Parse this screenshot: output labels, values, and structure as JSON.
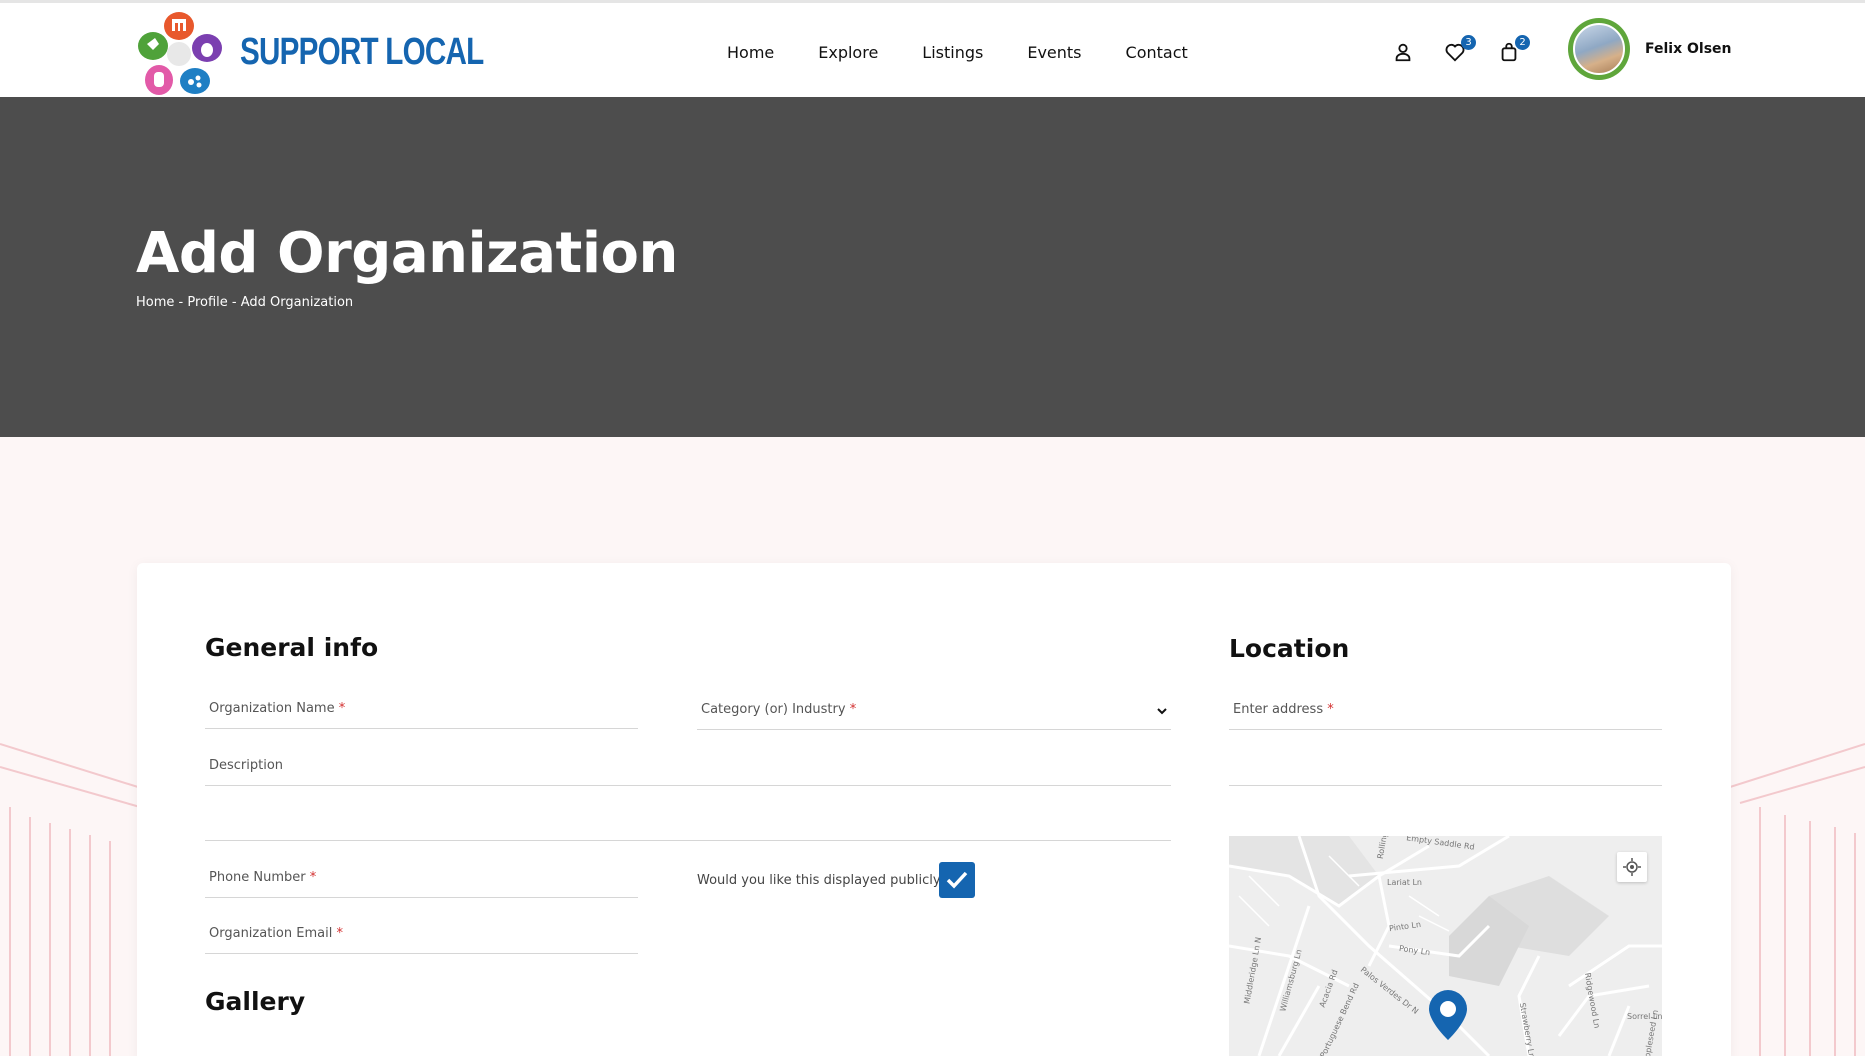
{
  "brand": {
    "name": "SUPPORT LOCAL",
    "color": "#1565b0"
  },
  "nav": {
    "items": [
      {
        "label": "Home"
      },
      {
        "label": "Explore"
      },
      {
        "label": "Listings"
      },
      {
        "label": "Events"
      },
      {
        "label": "Contact"
      }
    ]
  },
  "header_icons": {
    "account": "user-icon",
    "favorites": {
      "icon": "heart-icon",
      "count": "3"
    },
    "cart": {
      "icon": "shopping-bag-icon",
      "count": "2"
    }
  },
  "user": {
    "name": "Felix Olsen"
  },
  "hero": {
    "title": "Add Organization",
    "breadcrumb": [
      "Home",
      "Profile",
      "Add Organization"
    ],
    "separator": " - "
  },
  "general_info": {
    "title": "General info",
    "org_name_label": "Organization Name",
    "category_label": "Category (or) Industry",
    "description_label": "Description",
    "phone_label": "Phone Number",
    "public_question": "Would you like this displayed publicly?",
    "public_checked": true,
    "email_label": "Organization Email",
    "required_mark": "*"
  },
  "location": {
    "title": "Location",
    "address_label": "Enter address"
  },
  "gallery": {
    "title": "Gallery"
  },
  "map": {
    "streets": [
      "Empty Saddle Rd",
      "Lariat Ln",
      "Pinto Ln",
      "Pony Ln",
      "Middleridge Ln N",
      "Williamsburg Ln",
      "Acacia Rd",
      "Portuguese Bend Rd",
      "Palos Verdes Dr N",
      "Strawberry Ln",
      "Rolling",
      "Sorrel Ln",
      "Appleseed Ln",
      "Ridgewood Ln"
    ]
  }
}
